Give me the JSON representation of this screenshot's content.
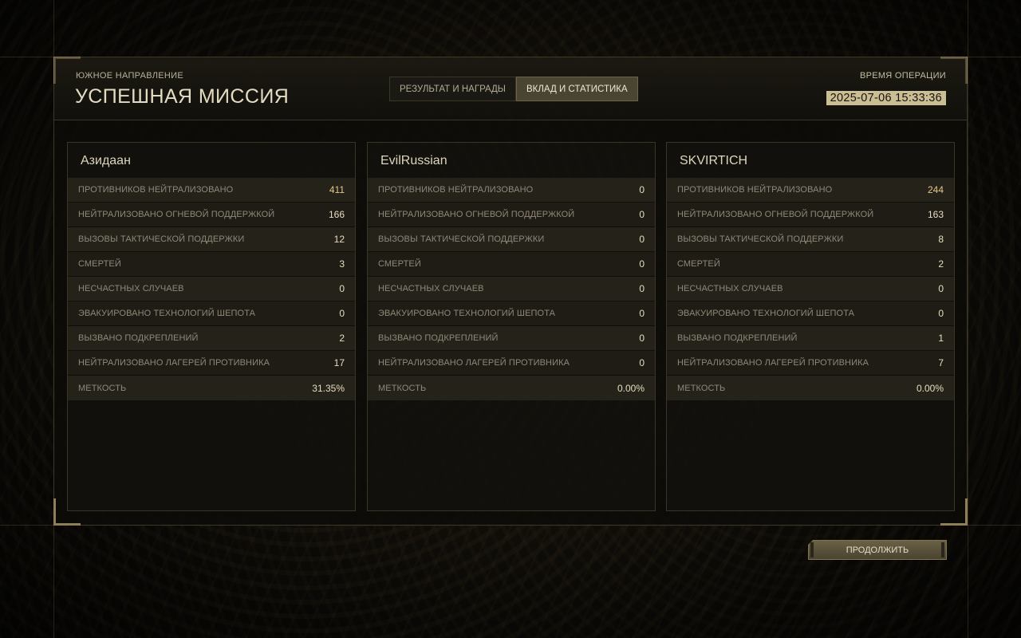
{
  "header": {
    "subtitle": "ЮЖНОЕ НАПРАВЛЕНИЕ",
    "title": "УСПЕШНАЯ МИССИЯ",
    "tabs": [
      {
        "label": "РЕЗУЛЬТАТ И НАГРАДЫ",
        "active": false
      },
      {
        "label": "ВКЛАД И СТАТИСТИКА",
        "active": true
      }
    ],
    "operation_time_label": "ВРЕМЯ ОПЕРАЦИИ",
    "operation_time_value": "2025-07-06 15:33:36"
  },
  "stat_labels": [
    "ПРОТИВНИКОВ НЕЙТРАЛИЗОВАНО",
    "НЕЙТРАЛИЗОВАНО ОГНЕВОЙ ПОДДЕРЖКОЙ",
    "ВЫЗОВЫ ТАКТИЧЕСКОЙ ПОДДЕРЖКИ",
    "СМЕРТЕЙ",
    "НЕСЧАСТНЫХ СЛУЧАЕВ",
    "ЭВАКУИРОВАНО ТЕХНОЛОГИЙ ШЕПОТА",
    "ВЫЗВАНО ПОДКРЕПЛЕНИЙ",
    "НЕЙТРАЛИЗОВАНО ЛАГЕРЕЙ ПРОТИВНИКА",
    "МЕТКОСТЬ"
  ],
  "players": [
    {
      "name": "Азидаан",
      "values": [
        "411",
        "166",
        "12",
        "3",
        "0",
        "0",
        "2",
        "17",
        "31.35%"
      ]
    },
    {
      "name": "EvilRussian",
      "values": [
        "0",
        "0",
        "0",
        "0",
        "0",
        "0",
        "0",
        "0",
        "0.00%"
      ]
    },
    {
      "name": "SKVIRTICH",
      "values": [
        "244",
        "163",
        "8",
        "2",
        "0",
        "0",
        "1",
        "7",
        "0.00%"
      ]
    }
  ],
  "footer": {
    "continue_label": "ПРОДОЛЖИТЬ"
  },
  "colors": {
    "accent_gold": "#e2c88a",
    "active_tab": "#4a4432",
    "time_badge": "#c9be94"
  }
}
